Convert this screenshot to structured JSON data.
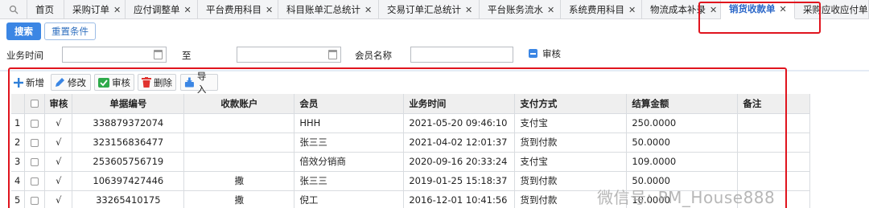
{
  "tabs": [
    {
      "label": "首页",
      "closable": false
    },
    {
      "label": "采购订单",
      "closable": true
    },
    {
      "label": "应付调整单",
      "closable": true
    },
    {
      "label": "平台费用科目",
      "closable": true
    },
    {
      "label": "科目账单汇总统计",
      "closable": true
    },
    {
      "label": "交易订单汇总统计",
      "closable": true
    },
    {
      "label": "平台账务流水",
      "closable": true
    },
    {
      "label": "系统费用科目",
      "closable": true
    },
    {
      "label": "物流成本补录",
      "closable": true
    },
    {
      "label": "销货收款单",
      "closable": true,
      "active": true
    },
    {
      "label": "采购应收应付单",
      "closable": false
    }
  ],
  "search": {
    "search_button": "搜索",
    "reset_button": "重置条件",
    "business_time_label": "业务时间",
    "to_label": "至",
    "member_label": "会员名称",
    "review_label": "审核",
    "date_from": "",
    "date_to": "",
    "member_value": ""
  },
  "toolbar": {
    "add": "新增",
    "edit": "修改",
    "review": "审核",
    "delete": "删除",
    "import": "导入"
  },
  "grid": {
    "columns": [
      "",
      "",
      "审核",
      "单据编号",
      "收款账户",
      "会员",
      "业务时间",
      "支付方式",
      "结算金额",
      "备注"
    ],
    "rows": [
      {
        "n": "1",
        "reviewed": "√",
        "doc_no": "338879372074",
        "account": "",
        "member": "HHH",
        "time": "2021-05-20 09:46:10",
        "pay": "支付宝",
        "amount": "250.0000",
        "note": ""
      },
      {
        "n": "2",
        "reviewed": "√",
        "doc_no": "323156836477",
        "account": "",
        "member": "张三三",
        "time": "2021-04-02 12:01:37",
        "pay": "货到付款",
        "amount": "50.0000",
        "note": ""
      },
      {
        "n": "3",
        "reviewed": "√",
        "doc_no": "253605756719",
        "account": "",
        "member": "倍效分销商",
        "time": "2020-09-16 20:33:24",
        "pay": "支付宝",
        "amount": "109.0000",
        "note": ""
      },
      {
        "n": "4",
        "reviewed": "√",
        "doc_no": "106397427446",
        "account": "撒",
        "member": "张三三",
        "time": "2019-01-25 15:18:37",
        "pay": "货到付款",
        "amount": "50.0000",
        "note": ""
      },
      {
        "n": "5",
        "reviewed": "√",
        "doc_no": "33265410175",
        "account": "撒",
        "member": "倪工",
        "time": "2016-12-01 10:41:56",
        "pay": "货到付款",
        "amount": "10.0000",
        "note": ""
      }
    ]
  },
  "watermark": "微信号: PM_House888",
  "colors": {
    "accent": "#3b86e4",
    "highlight": "#e0141e",
    "delete": "#e0332f",
    "review": "#2eaa4a"
  }
}
